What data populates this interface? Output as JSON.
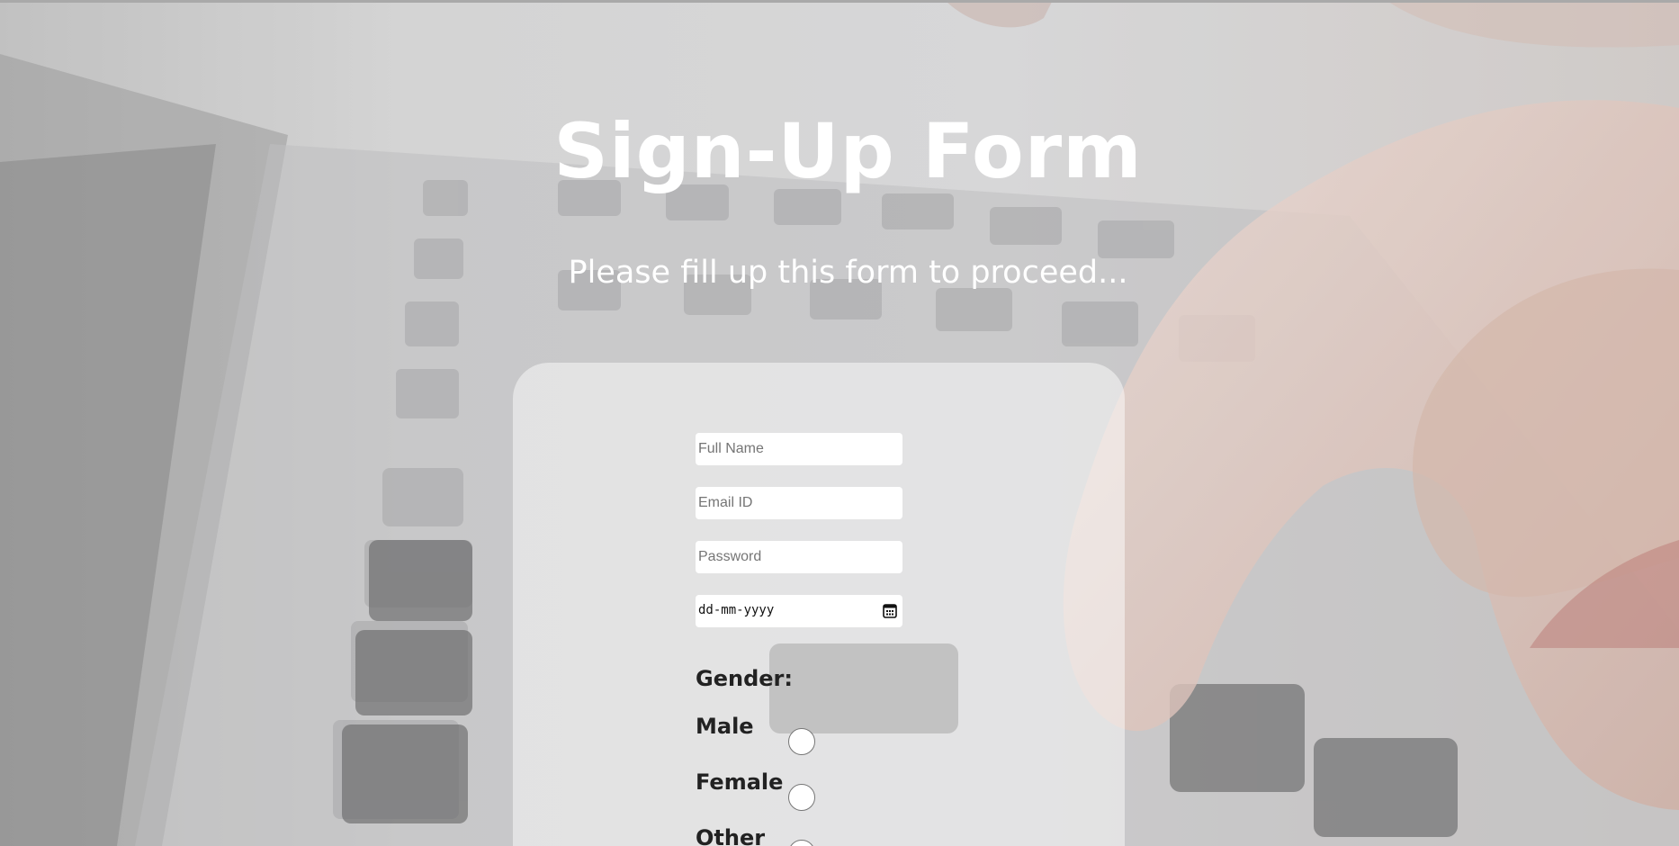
{
  "page": {
    "title": "Sign-Up Form",
    "subtitle": "Please fill up this form to proceed..."
  },
  "form": {
    "full_name_placeholder": "Full Name",
    "email_placeholder": "Email ID",
    "password_placeholder": "Password",
    "date_placeholder": "dd-mm-yyyy",
    "gender_label": "Gender:",
    "gender_options": [
      "Male",
      "Female",
      "Other"
    ]
  },
  "icons": {
    "date": "calendar-icon"
  },
  "colors": {
    "title_text": "#ffffff",
    "label_text": "#222222",
    "card_overlay": "rgba(255,255,255,0.48)",
    "input_bg": "#ffffff"
  }
}
